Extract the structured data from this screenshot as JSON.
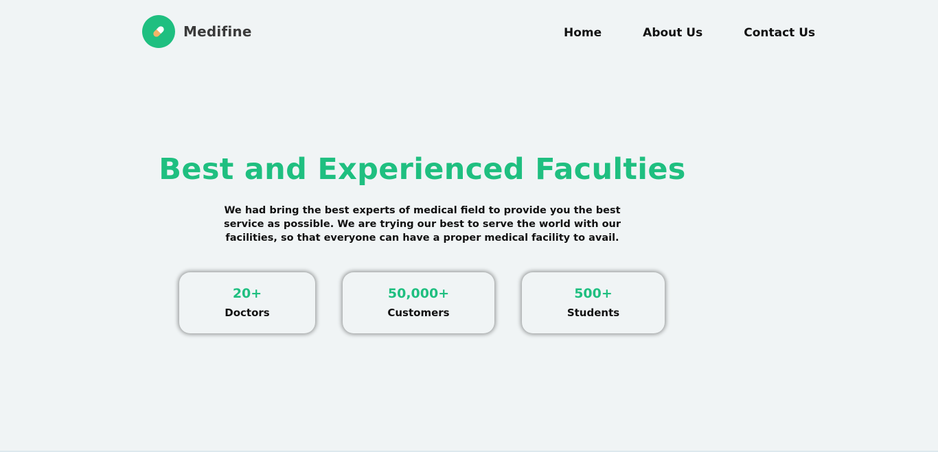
{
  "header": {
    "brand_name": "Medifine",
    "logo_icon": "pill-icon",
    "nav": {
      "home": "Home",
      "about": "About Us",
      "contact": "Contact Us"
    }
  },
  "hero": {
    "title": "Best and Experienced Faculties",
    "description": "We had bring the best experts of medical field to provide you the best service as possible. We are trying our best to serve the world with our facilities, so that everyone can have a proper medical facility to avail."
  },
  "stats": [
    {
      "value": "20+",
      "label": "Doctors"
    },
    {
      "value": "50,000+",
      "label": "Customers"
    },
    {
      "value": "500+",
      "label": "Students"
    }
  ],
  "colors": {
    "accent": "#1fbf80",
    "background": "#f0f4f5",
    "text": "#111111",
    "pill_light": "#ffffff",
    "pill_orange": "#f3b469"
  }
}
